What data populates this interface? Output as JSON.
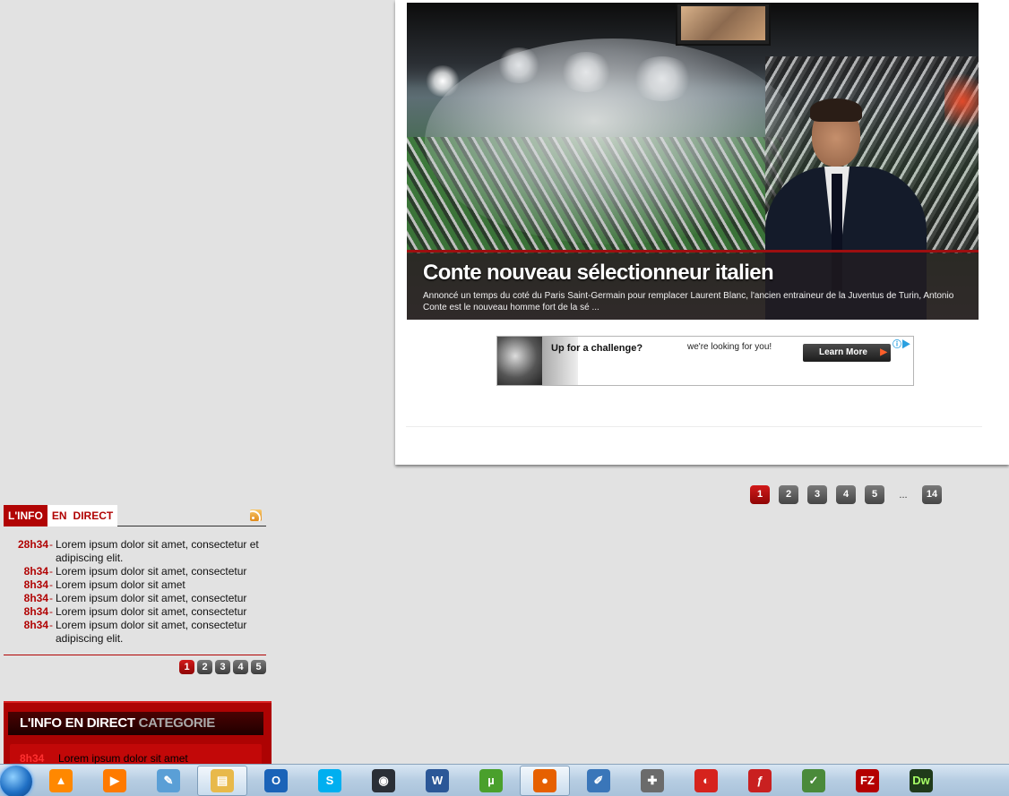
{
  "article": {
    "title": "Conte nouveau sélectionneur italien",
    "excerpt": "Annoncé un temps du coté du Paris Saint-Germain pour remplacer Laurent Blanc, l'ancien entraineur de la Juventus de Turin, Antonio Conte est le nouveau homme fort de la sé ..."
  },
  "ad": {
    "headline": "Up for a challenge?",
    "tagline": "we're looking for you!",
    "cta": "Learn More",
    "adchoices": "ⓘ▶"
  },
  "pagination": {
    "pages": [
      "1",
      "2",
      "3",
      "4",
      "5"
    ],
    "ellipsis": "...",
    "last": "14",
    "active": "1"
  },
  "live_feed": {
    "tab_linfo": "L'INFO",
    "tab_en": "EN",
    "tab_direct": "DIRECT",
    "separator": "-",
    "items": [
      {
        "time": "28h34",
        "text": "Lorem ipsum dolor sit amet, consectetur et adipiscing elit."
      },
      {
        "time": "8h34",
        "text": "Lorem ipsum dolor sit amet, consectetur"
      },
      {
        "time": "8h34",
        "text": "Lorem ipsum dolor sit amet"
      },
      {
        "time": "8h34",
        "text": "Lorem ipsum dolor sit amet, consectetur"
      },
      {
        "time": "8h34",
        "text": "Lorem ipsum dolor sit amet, consectetur"
      },
      {
        "time": "8h34",
        "text": "Lorem ipsum dolor sit amet, consectetur adipiscing elit."
      }
    ],
    "pages": [
      "1",
      "2",
      "3",
      "4",
      "5"
    ]
  },
  "category_box": {
    "heading": "L'INFO EN DIRECT",
    "heading_category": "CATEGORIE",
    "item_time": "8h34",
    "item_text": "Lorem ipsum dolor sit amet"
  },
  "taskbar": {
    "apps": [
      {
        "name": "vlc-icon",
        "glyph": "▲",
        "color": "#ff8800"
      },
      {
        "name": "media-player-icon",
        "glyph": "▶",
        "color": "#ff7a00"
      },
      {
        "name": "notepad-icon",
        "glyph": "✎",
        "color": "#5a9fd6"
      },
      {
        "name": "explorer-icon",
        "glyph": "▤",
        "color": "#e8b94a"
      },
      {
        "name": "outlook-icon",
        "glyph": "O",
        "color": "#1a63b8"
      },
      {
        "name": "skype-icon",
        "glyph": "S",
        "color": "#00aff0"
      },
      {
        "name": "steam-icon",
        "glyph": "◉",
        "color": "#2a2f36"
      },
      {
        "name": "word-icon",
        "glyph": "W",
        "color": "#2b5797"
      },
      {
        "name": "utorrent-icon",
        "glyph": "µ",
        "color": "#4aa02c"
      },
      {
        "name": "firefox-icon",
        "glyph": "●",
        "color": "#e66000"
      },
      {
        "name": "pen-tool-icon",
        "glyph": "✐",
        "color": "#3a76b9"
      },
      {
        "name": "gamepad-icon",
        "glyph": "✚",
        "color": "#6b6b6b"
      },
      {
        "name": "recorder-icon",
        "glyph": "◐",
        "color": "#d6231d"
      },
      {
        "name": "flash-icon",
        "glyph": "ƒ",
        "color": "#c92020"
      },
      {
        "name": "chart-editor-icon",
        "glyph": "✓",
        "color": "#4a8a3a"
      },
      {
        "name": "filezilla-icon",
        "glyph": "FZ",
        "color": "#b40000"
      },
      {
        "name": "dreamweaver-icon",
        "glyph": "Dw",
        "color": "#1f3a1a"
      }
    ]
  }
}
